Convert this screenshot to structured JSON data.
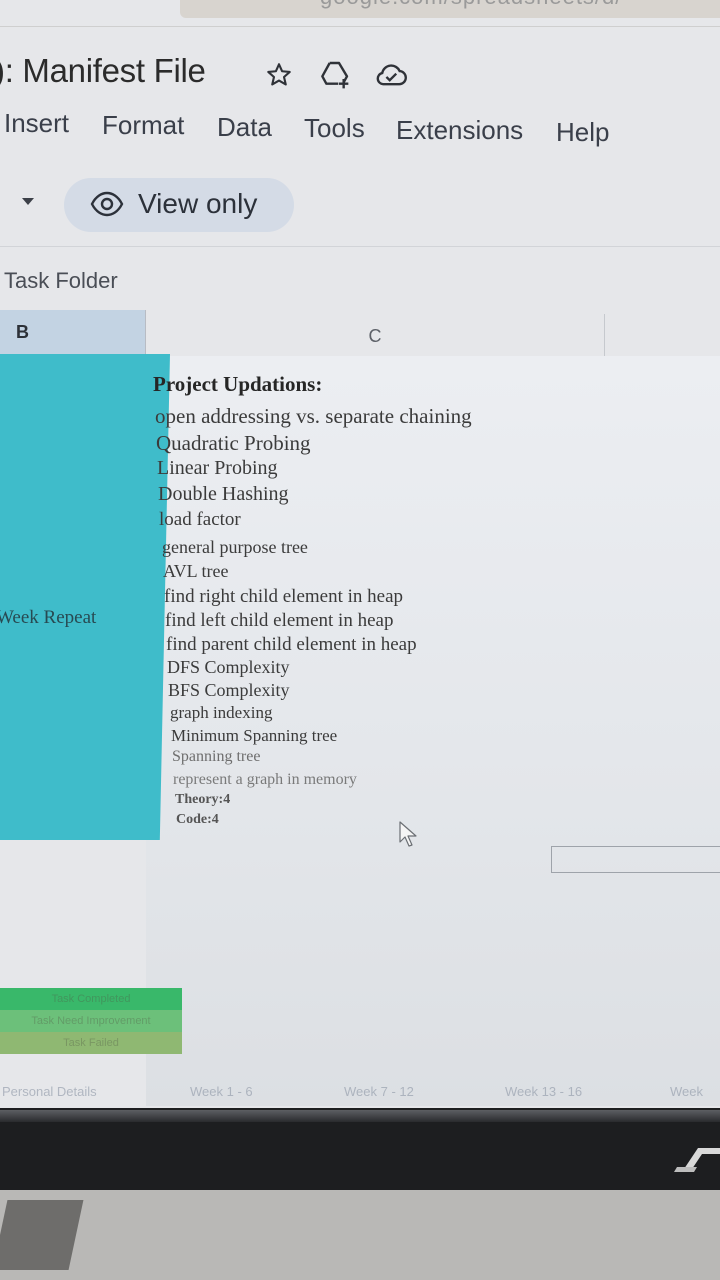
{
  "browser": {
    "url_fragment": "google.com/spreadsheets/d/"
  },
  "header": {
    "title": "): Manifest File"
  },
  "menu": {
    "items": [
      "Insert",
      "Format",
      "Data",
      "Tools",
      "Extensions",
      "Help"
    ]
  },
  "toolbar": {
    "view_only_label": "View only"
  },
  "name_box": {
    "value": "Task Folder"
  },
  "columns": {
    "b": "B",
    "c": "C"
  },
  "cells": {
    "b_value": "Week Repeat",
    "b_color": "#3fbcca"
  },
  "content": {
    "heading": "Project Updations:",
    "items": [
      "open addressing vs. separate chaining",
      "Quadratic Probing",
      "Linear Probing",
      "Double Hashing",
      "load factor",
      "general purpose tree",
      "AVL tree",
      "find right child element in heap",
      "find left child element in heap",
      "find parent child element in heap",
      "DFS Complexity",
      "BFS Complexity",
      "graph indexing",
      "Minimum Spanning tree",
      "Spanning tree",
      "represent a graph in memory"
    ],
    "theory": "Theory:4",
    "code": "Code:4"
  },
  "legend": {
    "rows": [
      {
        "label": "Task Completed",
        "color": "#39b86a"
      },
      {
        "label": "Task Need Improvement",
        "color": "#6cc07a"
      },
      {
        "label": "Task Failed",
        "color": "#8fb872"
      }
    ]
  },
  "sheet_tabs": [
    "Personal Details",
    "Week 1 - 6",
    "Week 7 - 12",
    "Week 13 - 16",
    "Week"
  ],
  "icons": {
    "title": [
      "star-icon",
      "drive-add-icon",
      "cloud-saved-icon"
    ],
    "view_only": "eye-icon"
  }
}
